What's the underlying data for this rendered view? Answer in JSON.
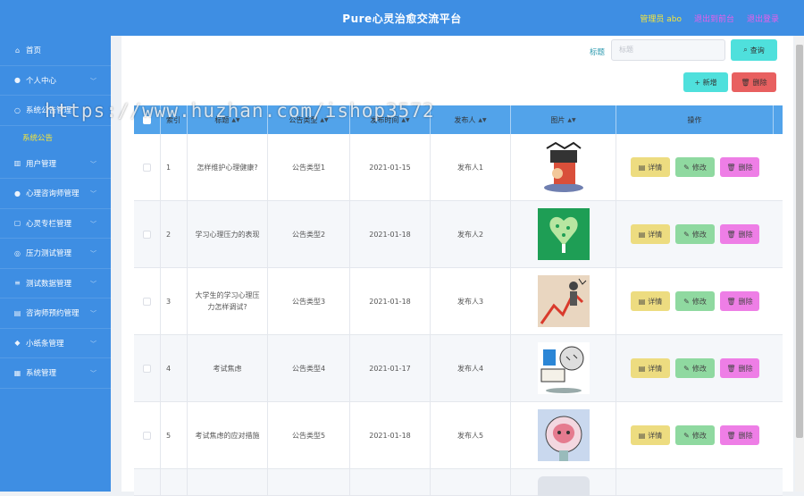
{
  "header": {
    "title": "Pure心灵治愈交流平台",
    "admin": "管理员 abo",
    "back_link": "退出到前台",
    "logout_link": "退出登录"
  },
  "sidebar": {
    "items": [
      {
        "label": "首页",
        "icon": "home-icon"
      },
      {
        "label": "个人中心",
        "icon": "user-icon"
      },
      {
        "label": "系统公告管理",
        "icon": "notice-icon"
      },
      {
        "label": "用户管理",
        "icon": "chart-icon"
      },
      {
        "label": "心理咨询师管理",
        "icon": "user-icon"
      },
      {
        "label": "心灵专栏管理",
        "icon": "column-icon"
      },
      {
        "label": "压力测试管理",
        "icon": "gauge-icon"
      },
      {
        "label": "测试数据管理",
        "icon": "list-icon"
      },
      {
        "label": "咨询师预约管理",
        "icon": "calendar-icon"
      },
      {
        "label": "小纸条管理",
        "icon": "note-icon"
      },
      {
        "label": "系统管理",
        "icon": "system-icon"
      }
    ],
    "active_sub": "系统公告"
  },
  "toolbar": {
    "search_label": "标题",
    "search_placeholder": "标题",
    "search_button": "查询",
    "add_button": "+ 新增",
    "delete_button": "删除"
  },
  "table": {
    "columns": {
      "index": "索引",
      "title": "标题",
      "type": "公告类型",
      "date": "发布时间",
      "publisher": "发布人",
      "image": "图片",
      "ops": "操作"
    },
    "rows": [
      {
        "index": "1",
        "title": "怎样维护心理健康?",
        "type": "公告类型1",
        "date": "2021-01-15",
        "publisher": "发布人1"
      },
      {
        "index": "2",
        "title": "学习心理压力的表现",
        "type": "公告类型2",
        "date": "2021-01-18",
        "publisher": "发布人2"
      },
      {
        "index": "3",
        "title": "大学生的学习心理压力怎样调试?",
        "type": "公告类型3",
        "date": "2021-01-18",
        "publisher": "发布人3"
      },
      {
        "index": "4",
        "title": "考试焦虑",
        "type": "公告类型4",
        "date": "2021-01-17",
        "publisher": "发布人4"
      },
      {
        "index": "5",
        "title": "考试焦虑的应对措施",
        "type": "公告类型5",
        "date": "2021-01-18",
        "publisher": "发布人5"
      }
    ],
    "ops": {
      "detail": "详情",
      "edit": "修改",
      "remove": "删除"
    }
  },
  "watermark": "https://www.huzhan.com/ishop3572",
  "colors": {
    "header": "#3e8ee3",
    "accent": "#4fe0dc",
    "danger": "#e86060",
    "table_head": "#52a3ea"
  }
}
